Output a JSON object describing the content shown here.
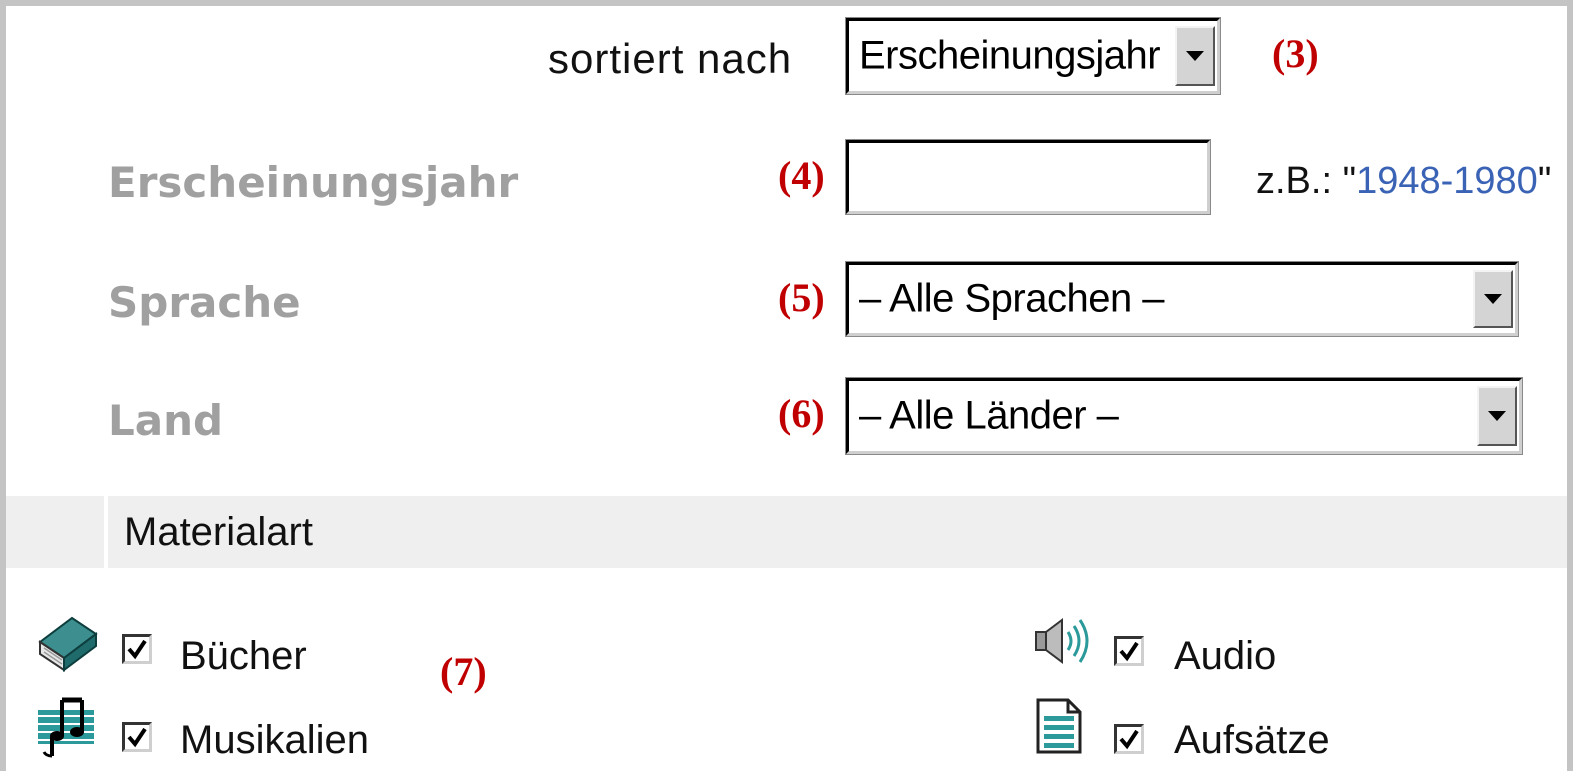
{
  "sort": {
    "label": "sortiert nach",
    "selected": "Erscheinungsjahr",
    "marker": "(3)"
  },
  "fields": {
    "year": {
      "label": "Erscheinungsjahr",
      "marker": "(4)",
      "value": "",
      "example_prefix": "z.B.: \"",
      "example_value": "1948-1980",
      "example_suffix": "\""
    },
    "language": {
      "label": "Sprache",
      "marker": "(5)",
      "selected": "– Alle Sprachen –"
    },
    "country": {
      "label": "Land",
      "marker": "(6)",
      "selected": "– Alle Länder –"
    }
  },
  "material": {
    "title": "Materialart",
    "marker": "(7)",
    "items": [
      {
        "label": "Bücher",
        "checked": true,
        "icon": "book-icon"
      },
      {
        "label": "Musikalien",
        "checked": true,
        "icon": "sheet-music-icon"
      },
      {
        "label": "Audio",
        "checked": true,
        "icon": "speaker-icon"
      },
      {
        "label": "Aufsätze",
        "checked": true,
        "icon": "document-icon"
      }
    ]
  },
  "colors": {
    "marker": "#c00000",
    "label_gray": "#a0a0a0",
    "example_blue": "#3a63b5",
    "band": "#efefef"
  }
}
